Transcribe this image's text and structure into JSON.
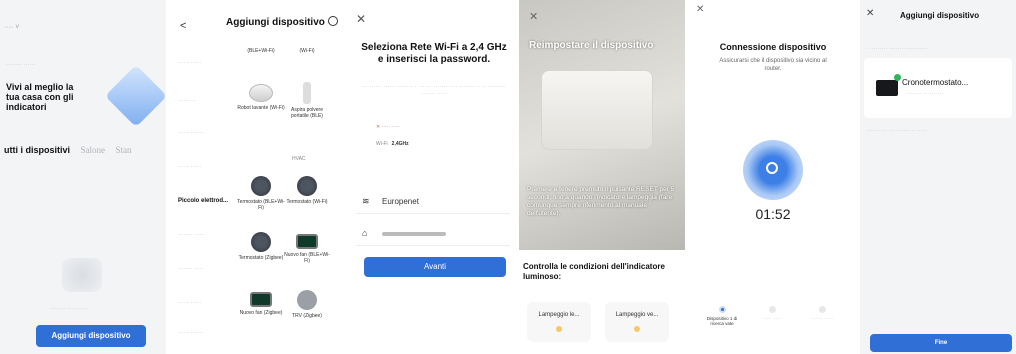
{
  "home": {
    "hero": "Vivi al meglio la tua casa con gli indicatori",
    "tab_active": "utti i dispositivi",
    "tab_2": "Salone",
    "tab_3": "Stan",
    "add_button": "Aggiungi dispositivo"
  },
  "add_device": {
    "title": "Aggiungi dispositivo",
    "categories": [
      "Piccolo elettrod..."
    ],
    "col_headers": [
      "(BLE+Wi-Fi)",
      "(Wi-Fi)"
    ],
    "hvac_label": "HVAC",
    "devices_top": [
      "Robot lavante (Wi-Fi)",
      "Aspira polvere portatile (BLE)"
    ],
    "devices": [
      "Termostato (BLE+Wi-Fi)",
      "Termostato (Wi-Fi)",
      "Termostato (Zigbee)",
      "Nuovo fan (BLE+Wi-Fi)",
      "Nuovo fan (Zigbee)",
      "TRV (Zigbee)"
    ]
  },
  "wifi": {
    "title": "Seleziona Rete Wi-Fi a 2,4 GHz e inserisci la password.",
    "band_label": "Wi-Fi",
    "band_value": "2,4GHz",
    "ssid": "Europenet",
    "next_button": "Avanti"
  },
  "reset": {
    "title": "Reimpostare il dispositivo",
    "description": "Premere e tenere premuto il pulsante RESET per 5 secondi, fino a quando l'indicatore lampeggia (fare comunque sempre riferimento al manuale dell'utente).",
    "check_title": "Controlla le condizioni dell'indicatore luminoso:",
    "options": [
      "Lampeggio le...",
      "Lampeggio ve..."
    ]
  },
  "connecting": {
    "title": "Connessione dispositivo",
    "subtitle": "Assicurarsi che il dispositivo sia vicino al router.",
    "timer": "01:52",
    "steps": [
      "Dispositivo 1 di ricerca vate"
    ]
  },
  "done": {
    "title": "Aggiungi dispositivo",
    "device_name": "Cronotermostato...",
    "finish_button": "Fine"
  },
  "colors": {
    "accent": "#2f6fd6",
    "success": "#2fb457"
  }
}
